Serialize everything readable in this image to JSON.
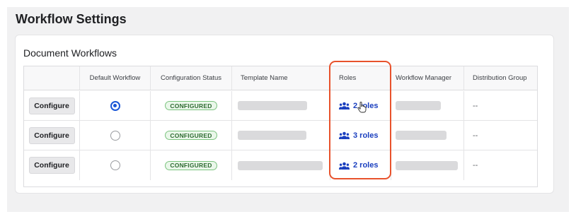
{
  "page": {
    "title": "Workflow Settings"
  },
  "card": {
    "title": "Document Workflows"
  },
  "table": {
    "headers": [
      "",
      "Default Workflow",
      "Configuration Status",
      "Template Name",
      "Roles",
      "Workflow Manager",
      "Distribution Group"
    ],
    "rows": [
      {
        "action": "Configure",
        "default_selected": true,
        "status": "CONFIGURED",
        "roles": "2 roles",
        "distribution": "--"
      },
      {
        "action": "Configure",
        "default_selected": false,
        "status": "CONFIGURED",
        "roles": "3 roles",
        "distribution": "--"
      },
      {
        "action": "Configure",
        "default_selected": false,
        "status": "CONFIGURED",
        "roles": "2 roles",
        "distribution": "--"
      }
    ]
  },
  "icons": {
    "roles": "people-group-icon",
    "cursor": "hand-pointer-icon",
    "radio": "radio-icon"
  },
  "colors": {
    "accent": "#1a56d6",
    "link": "#1a3fbf",
    "highlight": "#e8522c",
    "badge_border": "#7cc47f",
    "badge_text": "#2e6b31"
  }
}
